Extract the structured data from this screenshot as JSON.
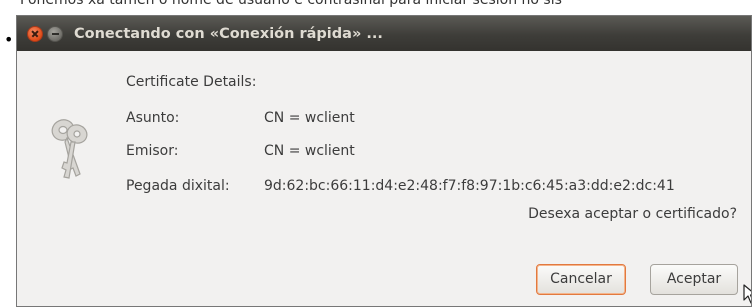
{
  "page": {
    "top_text": "Poñemos xa tamén o nome de usuario e contrasinal para iniciar sesión no sis",
    "bullet": "•"
  },
  "window": {
    "title": "Conectando con «Conexión rápida» ...",
    "close_icon": "close-icon",
    "minimize_icon": "minimize-icon"
  },
  "dialog": {
    "header": "Certificate Details:",
    "icon": "keys-icon",
    "fields": [
      {
        "label": "Asunto:",
        "value": "CN = wclient"
      },
      {
        "label": "Emisor:",
        "value": "CN = wclient"
      },
      {
        "label": "Pegada dixital:",
        "value": "9d:62:bc:66:11:d4:e2:48:f7:f8:97:1b:c6:45:a3:dd:e2:dc:41"
      }
    ],
    "question": "Desexa aceptar o certificado?",
    "buttons": {
      "cancel": "Cancelar",
      "accept": "Aceptar"
    }
  },
  "colors": {
    "titlebar": "#3c3b37",
    "title_text": "#dfdbd2",
    "close_button": "#df4a16",
    "focus_ring": "#e2793f"
  }
}
